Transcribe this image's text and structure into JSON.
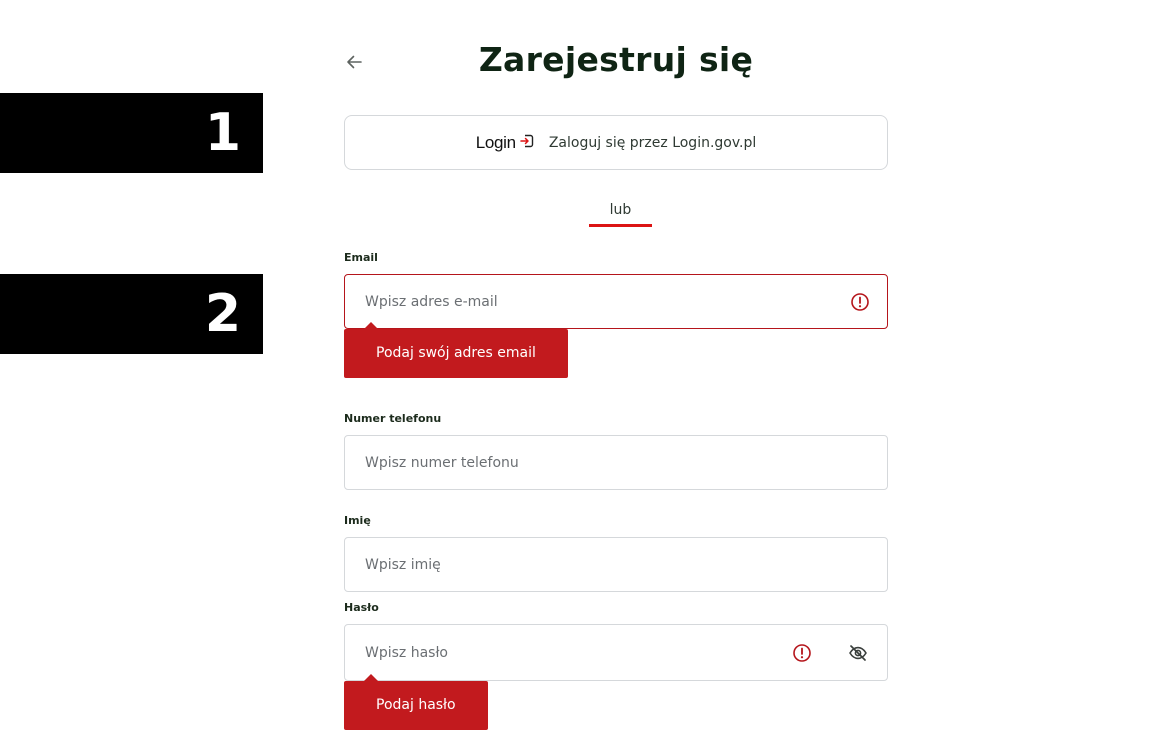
{
  "markers": {
    "first": "1",
    "second": "2"
  },
  "header": {
    "title": "Zarejestruj się"
  },
  "login_gov": {
    "logo_text": "Login",
    "label": "Zaloguj się przez Login.gov.pl"
  },
  "divider": {
    "text": "lub"
  },
  "form": {
    "email": {
      "label": "Email",
      "placeholder": "Wpisz adres e-mail",
      "value": "",
      "error": "Podaj swój adres email"
    },
    "phone": {
      "label": "Numer telefonu",
      "placeholder": "Wpisz numer telefonu",
      "value": ""
    },
    "first_name": {
      "label": "Imię",
      "placeholder": "Wpisz imię",
      "value": ""
    },
    "password": {
      "label": "Hasło",
      "placeholder": "Wpisz hasło",
      "value": "",
      "error": "Podaj hasło"
    }
  },
  "icons": {
    "back": "arrow-left-icon",
    "error": "exclamation-circle-icon",
    "visibility": "eye-off-icon",
    "login_logo": "login-door-icon"
  },
  "colors": {
    "accent_red": "#dc1414",
    "error_red": "#c21a1e",
    "title_dark": "#0f2414",
    "border_gray": "#d5d8db"
  }
}
